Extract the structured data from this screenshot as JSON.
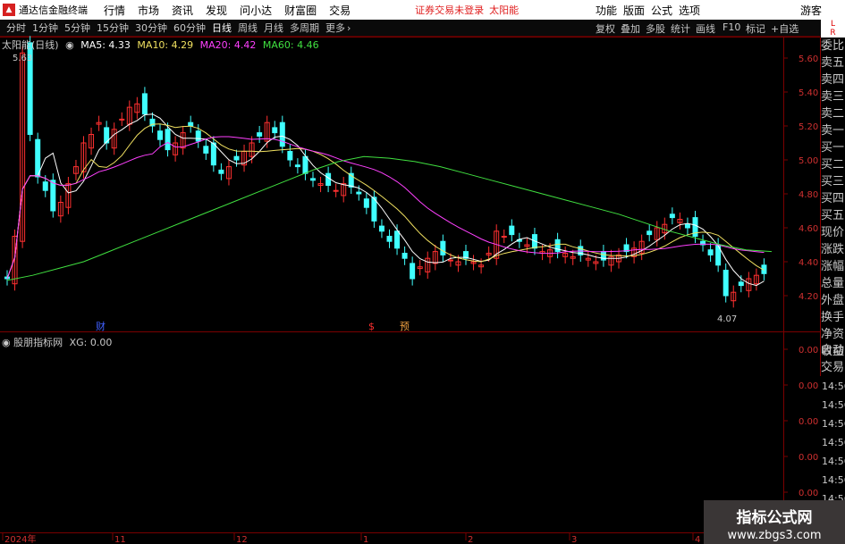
{
  "menubar": {
    "app_title": "通达信金融终端",
    "menus": [
      "行情",
      "市场",
      "资讯",
      "发现",
      "问小达",
      "财富圈",
      "交易"
    ],
    "notice": "证券交易未登录",
    "stock_name": "太阳能",
    "right_menus": [
      "功能",
      "版面",
      "公式",
      "选项"
    ],
    "user": "游客"
  },
  "toolbar": {
    "periods": [
      "分时",
      "1分钟",
      "5分钟",
      "15分钟",
      "30分钟",
      "60分钟",
      "日线",
      "周线",
      "月线",
      "多周期",
      "更多"
    ],
    "active_period": "日线",
    "tools": [
      "复权",
      "叠加",
      "多股",
      "统计",
      "画线",
      "F10",
      "标记",
      "+自选"
    ]
  },
  "badge": {
    "line1": "L",
    "line2": "R",
    "line3": "500"
  },
  "legend": {
    "title": "太阳能(日线)",
    "ma": [
      {
        "label": "MA5: 4.33",
        "color": "#ffffff"
      },
      {
        "label": "MA10: 4.29",
        "color": "#f0e060"
      },
      {
        "label": "MA20: 4.42",
        "color": "#ff40ff"
      },
      {
        "label": "MA60: 4.46",
        "color": "#40e040"
      }
    ]
  },
  "price_axis": [
    "5.60",
    "5.40",
    "5.20",
    "5.00",
    "4.80",
    "4.60",
    "4.40",
    "4.20"
  ],
  "annotations": {
    "high": "5.63",
    "low": "4.07",
    "marker_cai": "财",
    "marker_s": "$",
    "marker_yu": "预"
  },
  "indicator": {
    "label": "股朋指标网",
    "xg": "XG: 0.00",
    "axis": [
      "0.00",
      "0.00",
      "0.00",
      "0.00",
      "0.00"
    ],
    "times": [
      "14:56",
      "14:56",
      "14:56",
      "14:56",
      "14:56",
      "14:56",
      "14:56",
      "14:5"
    ]
  },
  "side_panel": [
    "委比",
    "卖五",
    "卖四",
    "卖三",
    "卖二",
    "卖一",
    "买一",
    "买二",
    "买三",
    "买四",
    "买五",
    "现价",
    "涨跌",
    "涨幅",
    "总量",
    "外盘",
    "换手",
    "净资",
    "收益"
  ],
  "side_panel2": [
    "自动",
    "交易"
  ],
  "time_axis": [
    "2024年",
    "11",
    "12",
    "1",
    "2",
    "3",
    "4"
  ],
  "watermark": {
    "main": "指标公式网",
    "url": "www.zbgs3.com"
  },
  "colors": {
    "up": "#ff3030",
    "down": "#40ffff",
    "ma5": "#ffffff",
    "ma10": "#f0e060",
    "ma20": "#ff40ff",
    "ma60": "#40e040",
    "grid": "#7a0000"
  }
}
